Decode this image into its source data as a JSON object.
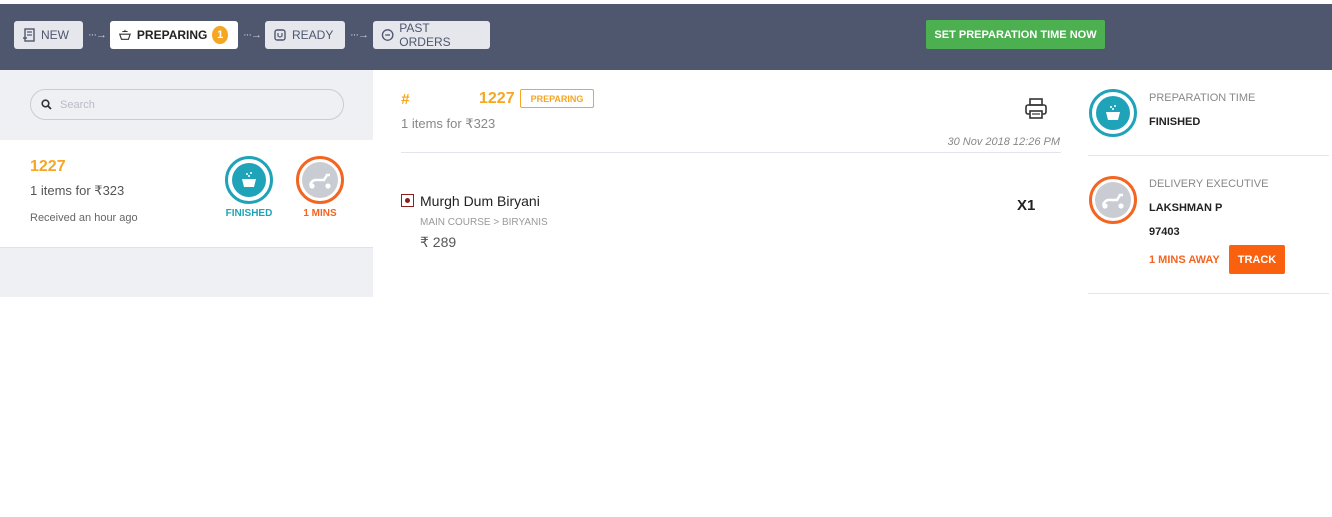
{
  "topbar": {
    "tabs": [
      {
        "label": "NEW",
        "icon": "receipt-icon"
      },
      {
        "label": "PREPARING",
        "icon": "pot-icon",
        "badge": "1",
        "active": true
      },
      {
        "label": "READY",
        "icon": "bag-icon"
      },
      {
        "label": "PAST ORDERS",
        "icon": "minus-circle-icon"
      }
    ],
    "arrow": "···→",
    "set_prep_label": "SET PREPARATION TIME NOW"
  },
  "sidebar": {
    "search_placeholder": "Search",
    "orders": [
      {
        "number": "1227",
        "summary": "1 items for ₹323",
        "received": "Received an hour ago",
        "prep_status": "FINISHED",
        "delivery_status": "1 MINS"
      }
    ]
  },
  "order": {
    "hash": "#",
    "number": "1227",
    "status": "PREPARING",
    "summary": "1 items for ₹323",
    "datetime": "30 Nov 2018 12:26 PM",
    "items": [
      {
        "name": "Murgh Dum Biryani",
        "category": "MAIN COURSE > BIRYANIS",
        "price": "₹ 289",
        "qty": "X1"
      }
    ]
  },
  "details": {
    "prep_label": "PREPARATION TIME",
    "prep_value": "FINISHED",
    "delivery_label": "DELIVERY EXECUTIVE",
    "executive_name": "LAKSHMAN P",
    "executive_code": "97403",
    "eta": "1 MINS AWAY",
    "track_label": "TRACK"
  },
  "colors": {
    "header_bg": "#4f576f",
    "accent_orange": "#f5a623",
    "teal": "#1fa3b9",
    "delivery_orange": "#f26522",
    "green_button": "#4caf50"
  }
}
